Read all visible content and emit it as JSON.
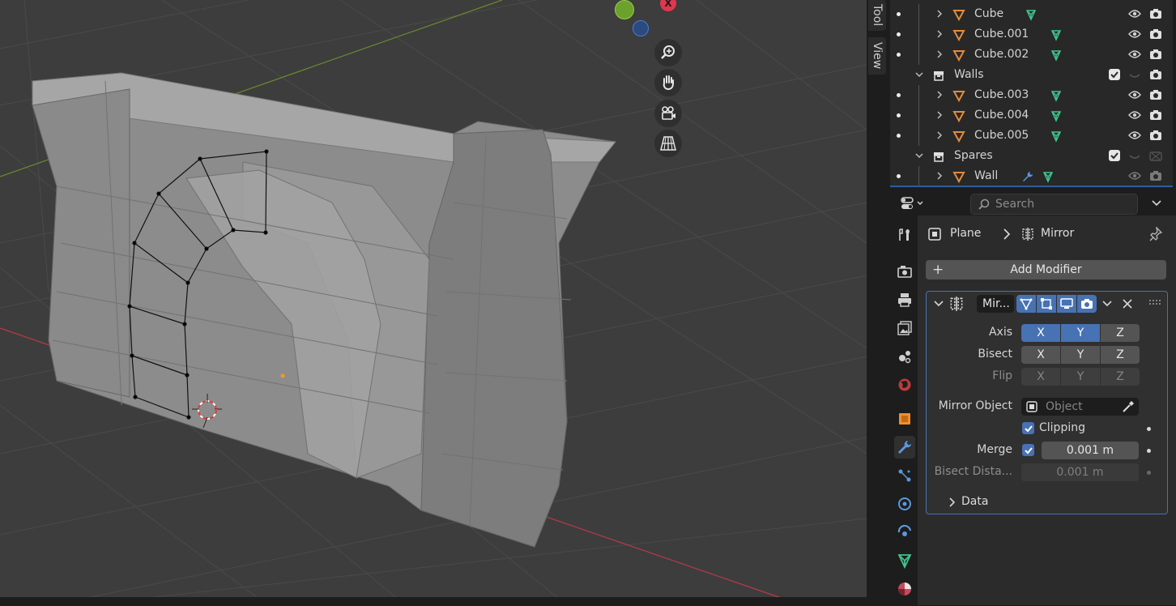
{
  "sidebar_tabs": {
    "tool": "Tool",
    "view": "View"
  },
  "gizmo": {
    "x_label": "X"
  },
  "outliner": {
    "rows": [
      {
        "label": "Cube",
        "kind": "mesh"
      },
      {
        "label": "Cube.001",
        "kind": "mesh"
      },
      {
        "label": "Cube.002",
        "kind": "mesh"
      },
      {
        "label": "Walls",
        "kind": "collection"
      },
      {
        "label": "Cube.003",
        "kind": "mesh"
      },
      {
        "label": "Cube.004",
        "kind": "mesh"
      },
      {
        "label": "Cube.005",
        "kind": "mesh"
      },
      {
        "label": "Spares",
        "kind": "collection"
      },
      {
        "label": "Wall",
        "kind": "mesh"
      }
    ]
  },
  "properties": {
    "search_placeholder": "Search",
    "breadcrumb": {
      "object": "Plane",
      "modifier": "Mirror"
    },
    "add_modifier": "Add Modifier",
    "modifier": {
      "name": "Mir...",
      "axis": {
        "label": "Axis",
        "x": "X",
        "y": "Y",
        "z": "Z",
        "x_on": true,
        "y_on": true,
        "z_on": false
      },
      "bisect": {
        "label": "Bisect",
        "x": "X",
        "y": "Y",
        "z": "Z"
      },
      "flip": {
        "label": "Flip",
        "x": "X",
        "y": "Y",
        "z": "Z"
      },
      "mirror_object": {
        "label": "Mirror Object",
        "placeholder": "Object"
      },
      "clipping": {
        "label": "Clipping",
        "checked": true
      },
      "merge": {
        "label": "Merge",
        "checked": true,
        "value": "0.001 m"
      },
      "bisect_distance": {
        "label": "Bisect Dista...",
        "value": "0.001 m"
      },
      "data_section": "Data"
    }
  },
  "colors": {
    "accent": "#4772b3",
    "x_axis": "#e0364f",
    "y_axis_green": "#8bb529",
    "z_axis": "#2f69c4"
  }
}
